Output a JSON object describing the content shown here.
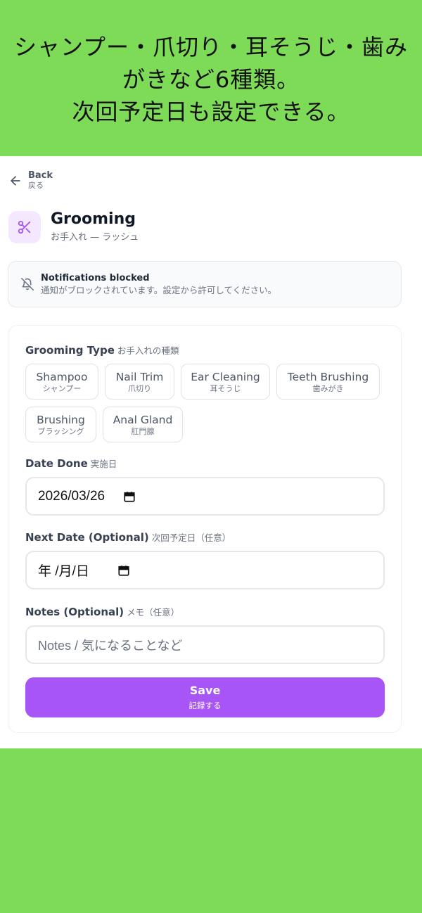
{
  "banner": {
    "lines": [
      "シャンプー・爪切り・耳そうじ・歯み",
      "がきなど6種類。",
      "次回予定日も設定できる。"
    ]
  },
  "back": {
    "label_en": "Back",
    "label_ja": "戻る",
    "icon": "arrow-left-icon"
  },
  "header": {
    "title": "Grooming",
    "subtitle": "お手入れ — ラッシュ",
    "icon": "scissors-icon",
    "accent": "#a855f7"
  },
  "notice": {
    "icon": "bell-off-icon",
    "title": "Notifications blocked",
    "body": "通知がブロックされています。設定から許可してください。"
  },
  "form": {
    "grooming_type": {
      "label_en": "Grooming Type",
      "label_ja": "お手入れの種類",
      "options": [
        {
          "en": "Shampoo",
          "ja": "シャンプー"
        },
        {
          "en": "Nail Trim",
          "ja": "爪切り"
        },
        {
          "en": "Ear Cleaning",
          "ja": "耳そうじ"
        },
        {
          "en": "Teeth Brushing",
          "ja": "歯みがき"
        },
        {
          "en": "Brushing",
          "ja": "ブラッシング"
        },
        {
          "en": "Anal Gland",
          "ja": "肛門腺"
        }
      ]
    },
    "date_done": {
      "label_en": "Date Done",
      "label_ja": "実施日",
      "value": "2026/03/26"
    },
    "next_date": {
      "label_en": "Next Date (Optional)",
      "label_ja": "次回予定日（任意）",
      "value": "年 /月/日"
    },
    "notes": {
      "label_en": "Notes (Optional)",
      "label_ja": "メモ（任意）",
      "placeholder": "Notes / 気になることなど"
    },
    "save": {
      "label_en": "Save",
      "label_ja": "記録する",
      "color": "#a855f7"
    }
  }
}
